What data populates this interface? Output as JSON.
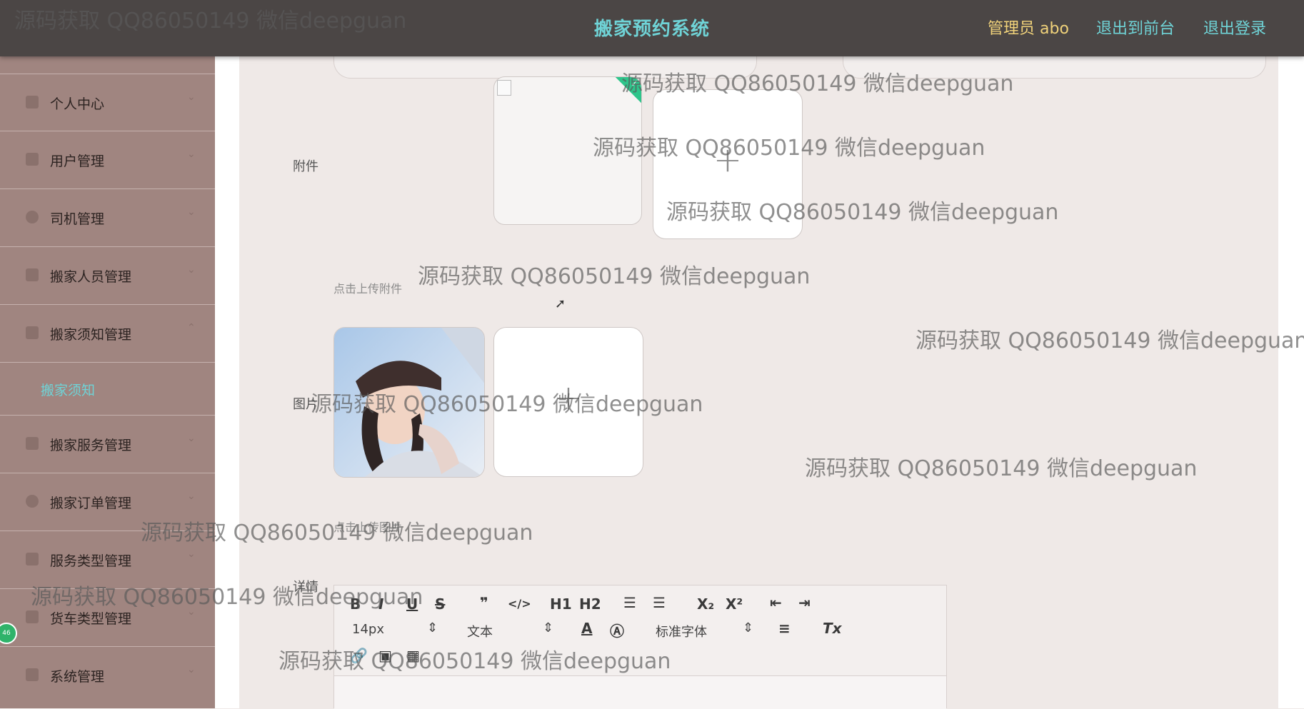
{
  "header": {
    "title": "搬家预约系统",
    "admin": "管理员 abo",
    "to_front": "退出到前台",
    "logout": "退出登录"
  },
  "sidebar": {
    "items": [
      {
        "label": "个人中心",
        "icon": "user-icon"
      },
      {
        "label": "用户管理",
        "icon": "grid-icon"
      },
      {
        "label": "司机管理",
        "icon": "clock-icon"
      },
      {
        "label": "搬家人员管理",
        "icon": "truck-icon"
      },
      {
        "label": "搬家须知管理",
        "icon": "briefcase-icon"
      },
      {
        "label": "搬家服务管理",
        "icon": "folder-icon"
      },
      {
        "label": "搬家订单管理",
        "icon": "power-icon"
      },
      {
        "label": "服务类型管理",
        "icon": "edit-icon"
      },
      {
        "label": "货车类型管理",
        "icon": "list-icon"
      },
      {
        "label": "系统管理",
        "icon": "chat-icon"
      }
    ],
    "sub_item": "搬家须知",
    "badge": "46"
  },
  "form": {
    "attachment_label": "附件",
    "attachment_hint": "点击上传附件",
    "image_label": "图片",
    "image_hint": "点击上传图片",
    "detail_label": "详情"
  },
  "editor": {
    "font_size": "14px",
    "paragraph": "文本",
    "font_family": "标准字体",
    "buttons": [
      "B",
      "I",
      "U",
      "S",
      "❞",
      "</>",
      "H1",
      "H2",
      "ordered-list",
      "bullet-list",
      "X₂",
      "X²",
      "outdent",
      "indent"
    ]
  },
  "watermark": "源码获取 QQ86050149 微信deepguan",
  "colors": {
    "header_bg": "#4b4645",
    "title": "#6fd3d6",
    "admin": "#f0d27a",
    "sidebar_bg": "#a08580",
    "panel_bg": "#efe9e7",
    "success": "#2ec58b"
  }
}
